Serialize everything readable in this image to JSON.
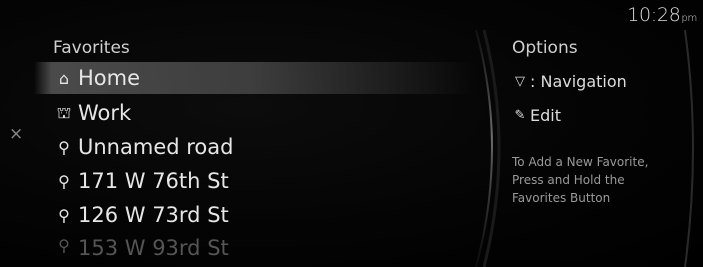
{
  "clock": {
    "time": "10:28",
    "ampm": "pm"
  },
  "close": {
    "icon": "close-icon",
    "glyph": "×"
  },
  "favorites": {
    "title": "Favorites",
    "items": [
      {
        "label": "Home",
        "icon": "home-icon",
        "glyph": "⌂"
      },
      {
        "label": "Work",
        "icon": "briefcase-icon",
        "glyph": "⛫"
      },
      {
        "label": "Unnamed road",
        "icon": "pin-icon",
        "glyph": "⚲"
      },
      {
        "label": "171 W 76th St",
        "icon": "pin-icon",
        "glyph": "⚲"
      },
      {
        "label": "126 W 73rd St",
        "icon": "pin-icon",
        "glyph": "⚲"
      },
      {
        "label": "153 W 93rd St",
        "icon": "pin-icon",
        "glyph": "⚲"
      }
    ],
    "selected_index": 0
  },
  "options": {
    "title": "Options",
    "navigation": {
      "label": ": Navigation",
      "icon": "filter-icon",
      "glyph": "▽"
    },
    "edit": {
      "label": "Edit",
      "icon": "pencil-icon",
      "glyph": "✎"
    },
    "hint": "To Add a New Favorite, Press and Hold the Favorites Button"
  }
}
